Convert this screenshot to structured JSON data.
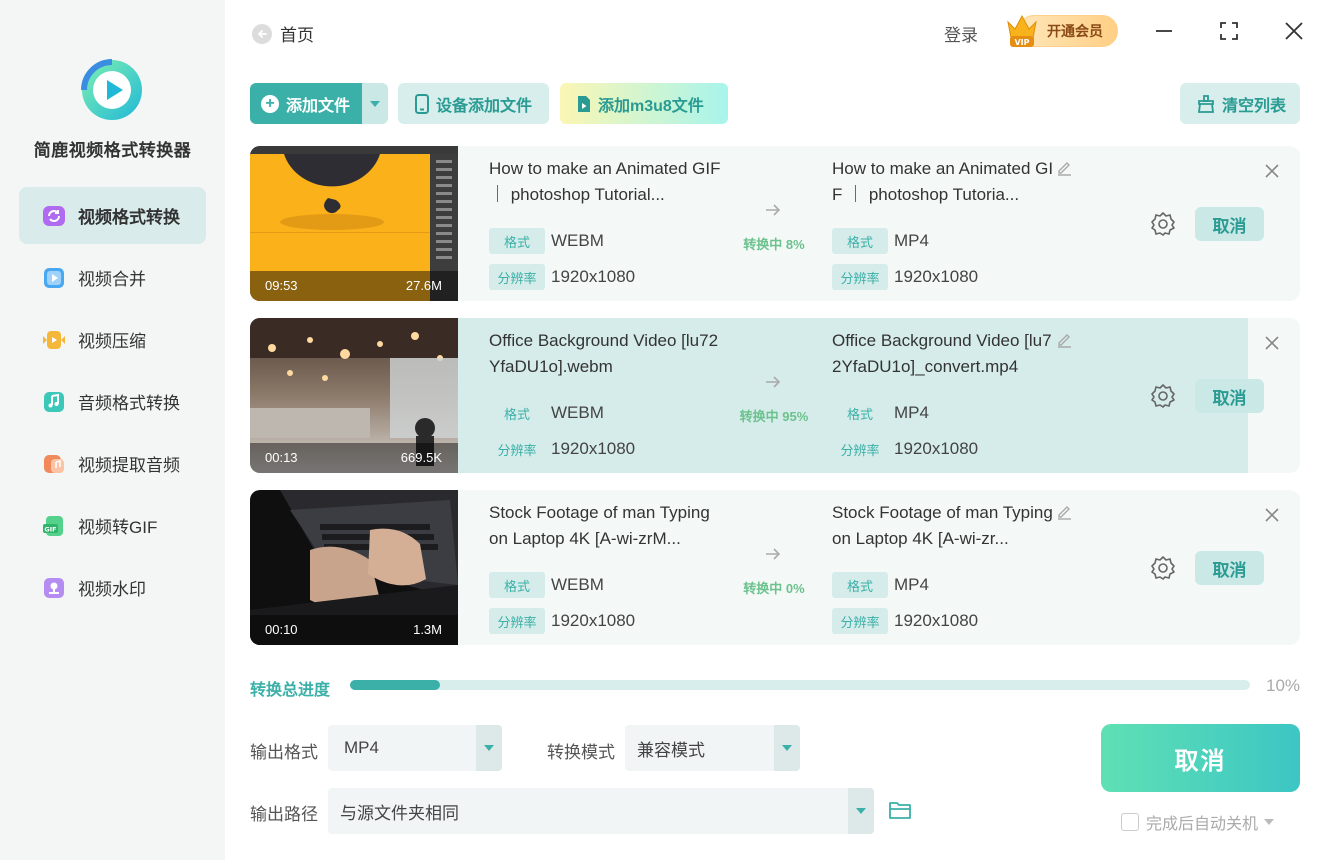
{
  "app": {
    "name": "简鹿视频格式转换器",
    "colors": {
      "accent": "#3bb0a8",
      "accent_light": "#d5ecea",
      "status_green": "#6cc28d",
      "vip_gold": "#ffcf85"
    }
  },
  "sidebar": {
    "items": [
      {
        "label": "视频格式转换",
        "icon": "video-convert-icon",
        "active": true
      },
      {
        "label": "视频合并",
        "icon": "video-merge-icon",
        "active": false
      },
      {
        "label": "视频压缩",
        "icon": "video-compress-icon",
        "active": false
      },
      {
        "label": "音频格式转换",
        "icon": "audio-convert-icon",
        "active": false
      },
      {
        "label": "视频提取音频",
        "icon": "extract-audio-icon",
        "active": false
      },
      {
        "label": "视频转GIF",
        "icon": "video-gif-icon",
        "active": false
      },
      {
        "label": "视频水印",
        "icon": "video-watermark-icon",
        "active": false
      }
    ]
  },
  "header": {
    "back_label": "首页",
    "login_label": "登录",
    "vip_label": "开通会员",
    "vip_badge": "VIP"
  },
  "toolbar": {
    "add_file": "添加文件",
    "device_add": "设备添加文件",
    "add_m3u8": "添加m3u8文件",
    "clear_list": "清空列表"
  },
  "files": [
    {
      "thumb": "thumb-photoshop",
      "duration": "09:53",
      "size": "27.6M",
      "src_name": "How to make an Animated GIF ｜ photoshop Tutorial...",
      "dst_name": "How to make an Animated GIF ｜ photoshop Tutoria...",
      "format_tag": "格式",
      "res_tag": "分辨率",
      "src_format": "WEBM",
      "dst_format": "MP4",
      "src_res": "1920x1080",
      "dst_res": "1920x1080",
      "status": "转换中 8%",
      "progress": 0.08,
      "cancel_label": "取消"
    },
    {
      "thumb": "thumb-office",
      "duration": "00:13",
      "size": "669.5K",
      "src_name": "Office Background Video [lu72YfaDU1o].webm",
      "dst_name": "Office Background Video [lu72YfaDU1o]_convert.mp4",
      "format_tag": "格式",
      "res_tag": "分辨率",
      "src_format": "WEBM",
      "dst_format": "MP4",
      "src_res": "1920x1080",
      "dst_res": "1920x1080",
      "status": "转换中 95%",
      "progress": 0.95,
      "cancel_label": "取消"
    },
    {
      "thumb": "thumb-typing",
      "duration": "00:10",
      "size": "1.3M",
      "src_name": "Stock Footage of man Typing on Laptop 4K [A-wi-zrM...",
      "dst_name": "Stock Footage of man Typing on Laptop 4K [A-wi-zr...",
      "format_tag": "格式",
      "res_tag": "分辨率",
      "src_format": "WEBM",
      "dst_format": "MP4",
      "src_res": "1920x1080",
      "dst_res": "1920x1080",
      "status": "转换中 0%",
      "progress": 0,
      "cancel_label": "取消"
    }
  ],
  "total": {
    "label": "转换总进度",
    "percent_text": "10%",
    "progress": 0.1
  },
  "settings": {
    "output_format_label": "输出格式",
    "output_format_value": "MP4",
    "mode_label": "转换模式",
    "mode_value": "兼容模式",
    "output_path_label": "输出路径",
    "output_path_value": "与源文件夹相同"
  },
  "actions": {
    "cancel_all": "取消",
    "auto_shutdown": "完成后自动关机"
  }
}
